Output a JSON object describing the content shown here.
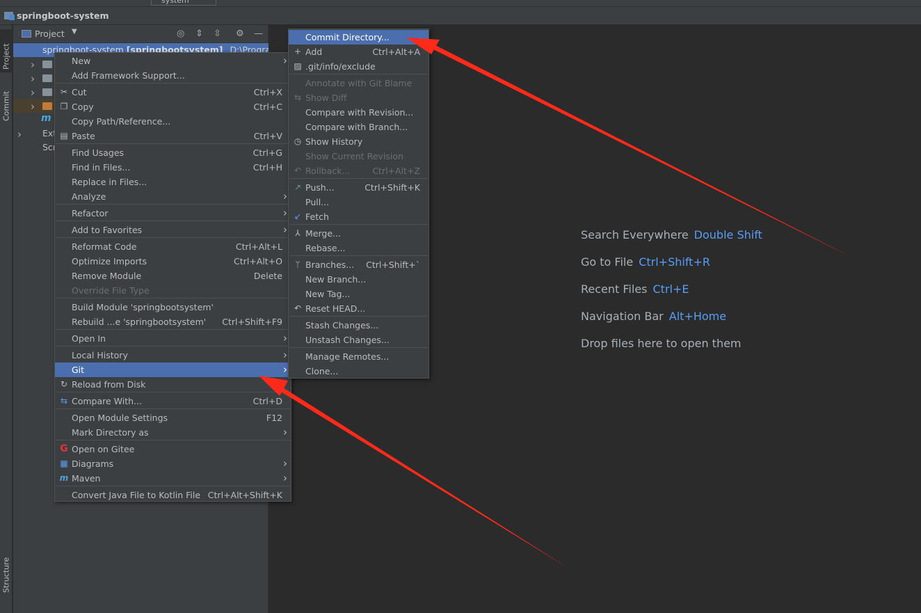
{
  "toolbar": {
    "run_config": "system"
  },
  "navbar": {
    "project_title": "springboot-system"
  },
  "left_strip": {
    "project_tab": "Project",
    "commit_tab": "Commit",
    "structure_tab": "Structure"
  },
  "project_panel": {
    "title": "Project",
    "root": {
      "name": "springboot-system",
      "module": "[springbootsystem]",
      "path": "D:\\Program Fil"
    },
    "rows": [
      {
        "label": ""
      },
      {
        "label": ""
      },
      {
        "label": ""
      },
      {
        "label": ""
      },
      {
        "label": "m"
      },
      {
        "label": "Ext"
      },
      {
        "label": "Scr"
      }
    ]
  },
  "context_menu": {
    "items": [
      {
        "label": "New",
        "submenu": true
      },
      {
        "label": "Add Framework Support..."
      },
      {
        "label": "Cut",
        "shortcut": "Ctrl+X",
        "icon": "scissors-icon"
      },
      {
        "label": "Copy",
        "shortcut": "Ctrl+C",
        "icon": "copy-icon"
      },
      {
        "label": "Copy Path/Reference..."
      },
      {
        "label": "Paste",
        "shortcut": "Ctrl+V",
        "icon": "paste-icon"
      },
      {
        "label": "Find Usages",
        "shortcut": "Ctrl+G"
      },
      {
        "label": "Find in Files...",
        "shortcut": "Ctrl+H"
      },
      {
        "label": "Replace in Files..."
      },
      {
        "label": "Analyze",
        "submenu": true
      },
      {
        "label": "Refactor",
        "submenu": true
      },
      {
        "label": "Add to Favorites",
        "submenu": true
      },
      {
        "label": "Reformat Code",
        "shortcut": "Ctrl+Alt+L"
      },
      {
        "label": "Optimize Imports",
        "shortcut": "Ctrl+Alt+O"
      },
      {
        "label": "Remove Module",
        "shortcut": "Delete"
      },
      {
        "label": "Override File Type",
        "disabled": true
      },
      {
        "label": "Build Module 'springbootsystem'"
      },
      {
        "label": "Rebuild ...e 'springbootsystem'",
        "shortcut": "Ctrl+Shift+F9"
      },
      {
        "label": "Open In",
        "submenu": true
      },
      {
        "label": "Local History",
        "submenu": true
      },
      {
        "label": "Git",
        "submenu": true,
        "selected": true
      },
      {
        "label": "Reload from Disk",
        "icon": "reload-icon"
      },
      {
        "label": "Compare With...",
        "shortcut": "Ctrl+D",
        "icon": "compare-icon"
      },
      {
        "label": "Open Module Settings",
        "shortcut": "F12"
      },
      {
        "label": "Mark Directory as",
        "submenu": true
      },
      {
        "label": "Open on Gitee",
        "icon": "gitee-icon"
      },
      {
        "label": "Diagrams",
        "submenu": true,
        "icon": "diagram-icon"
      },
      {
        "label": "Maven",
        "submenu": true,
        "icon": "maven-icon"
      },
      {
        "label": "Convert Java File to Kotlin File",
        "shortcut": "Ctrl+Alt+Shift+K"
      }
    ]
  },
  "git_menu": {
    "items": [
      {
        "label": "Commit Directory...",
        "selected": true
      },
      {
        "label": "Add",
        "shortcut": "Ctrl+Alt+A",
        "icon": "plus-icon"
      },
      {
        "label": ".git/info/exclude",
        "icon": "git-file-icon"
      },
      {
        "label": "Annotate with Git Blame",
        "disabled": true
      },
      {
        "label": "Show Diff",
        "disabled": true,
        "icon": "diff-icon"
      },
      {
        "label": "Compare with Revision..."
      },
      {
        "label": "Compare with Branch..."
      },
      {
        "label": "Show History",
        "icon": "history-icon"
      },
      {
        "label": "Show Current Revision",
        "disabled": true
      },
      {
        "label": "Rollback...",
        "shortcut": "Ctrl+Alt+Z",
        "disabled": true,
        "icon": "rollback-icon"
      },
      {
        "label": "Push...",
        "shortcut": "Ctrl+Shift+K",
        "icon": "push-icon"
      },
      {
        "label": "Pull..."
      },
      {
        "label": "Fetch",
        "icon": "fetch-icon"
      },
      {
        "label": "Merge...",
        "icon": "merge-icon"
      },
      {
        "label": "Rebase..."
      },
      {
        "label": "Branches...",
        "shortcut": "Ctrl+Shift+`",
        "icon": "branch-icon"
      },
      {
        "label": "New Branch..."
      },
      {
        "label": "New Tag..."
      },
      {
        "label": "Reset HEAD...",
        "icon": "reset-icon"
      },
      {
        "label": "Stash Changes..."
      },
      {
        "label": "Unstash Changes..."
      },
      {
        "label": "Manage Remotes..."
      },
      {
        "label": "Clone..."
      }
    ]
  },
  "editor_hints": [
    {
      "text": "Search Everywhere",
      "key": "Double Shift"
    },
    {
      "text": "Go to File",
      "key": "Ctrl+Shift+R"
    },
    {
      "text": "Recent Files",
      "key": "Ctrl+E"
    },
    {
      "text": "Navigation Bar",
      "key": "Alt+Home"
    },
    {
      "text": "Drop files here to open them",
      "key": ""
    }
  ],
  "colors": {
    "selection": "#4b6eaf",
    "link_key": "#589df6",
    "annotation": "#ff2a1a"
  }
}
